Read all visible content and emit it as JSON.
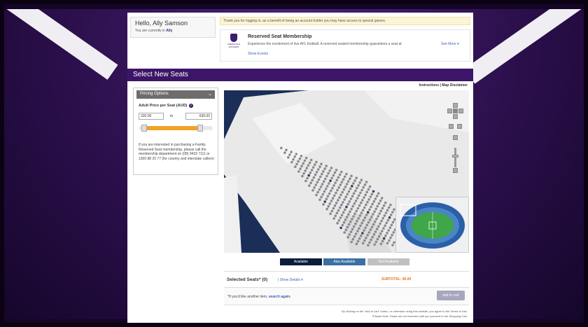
{
  "greeting": {
    "hello": "Hello, Ally Samson",
    "current_prefix": "You are currently in",
    "current_user": "Ally"
  },
  "notice": "Thank you for logging in, as a benefit of being an account holder you may have access to special games.",
  "event": {
    "logo_text": "FREMANTLE DOCKERS",
    "title": "Reserved Seat Membership",
    "description": "Experience the excitement of live AFL football. A reserved seated membership guarantees a seat at",
    "see_more": "See More",
    "show_events": "Show Events"
  },
  "section_title": "Select New Seats",
  "links": {
    "instructions": "Instructions | Map Disclaimer"
  },
  "pricing": {
    "header": "Pricing Options",
    "adult_label": "Adult Price per Seat (AUD)",
    "min": "330.00",
    "to": "to",
    "max": "635.00",
    "range_fraction": [
      0.0,
      0.85
    ],
    "info": "If you are interested in purchasing a Family Reserved Seat membership, please call the membership department on (08) 9433 7111 or 1300 88 20 77 (for country and interstate callers)"
  },
  "legend": {
    "available": "Available",
    "also_available": "Also Available",
    "not_available": "Not Available"
  },
  "selection": {
    "selected_label": "Selected Seats* (0)",
    "show_details": "| Show Details",
    "subtotal": "SUBTOTAL: $0.00",
    "another_prefix": "*If you'd like another item,",
    "search_again": "search again.",
    "add_to_cart": "add to cart"
  },
  "terms": {
    "line1": "By clicking on the \"add to cart\" button, or otherwise using this website, you agree to the Terms of Use.",
    "line2": "*Please Note: Seats are not reserved until you proceed to the Shopping Cart."
  },
  "colors": {
    "purple": "#3d1568",
    "orange": "#f0a326",
    "navy": "#1a2e57",
    "link": "#3d63b5"
  }
}
